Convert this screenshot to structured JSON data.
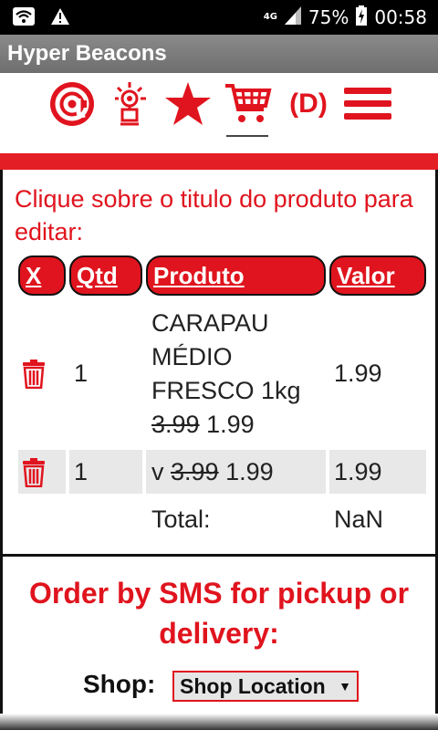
{
  "status_bar": {
    "network": "4G",
    "battery": "75%",
    "time": "00:58",
    "icons": [
      "wifi-icon",
      "warning-icon",
      "signal-icon",
      "battery-charging-icon"
    ]
  },
  "app": {
    "title": "Hyper Beacons"
  },
  "nav": {
    "icons": [
      "at-icon",
      "beacon-icon",
      "star-icon",
      "cart-icon",
      "d-label",
      "menu-icon"
    ],
    "d_label": "(D)",
    "accent_color": "#e0141e"
  },
  "cart": {
    "instruction": "Clique sobre o titulo do produto para editar:",
    "headers": {
      "remove": "X",
      "qty": "Qtd",
      "product": "Produto",
      "value": "Valor"
    },
    "rows": [
      {
        "qty": "1",
        "product": "CARAPAU MÉDIO FRESCO 1kg",
        "old_price": "3.99",
        "new_price": "1.99",
        "value": "1.99"
      },
      {
        "qty": "1",
        "prefix": "v",
        "old_price": "3.99",
        "new_price": "1.99",
        "value": "1.99"
      }
    ],
    "total_label": "Total:",
    "total_value": "NaN"
  },
  "order": {
    "title": "Order by SMS for pickup or delivery:",
    "shop_label": "Shop:",
    "shop_select_value": "Shop Location"
  }
}
